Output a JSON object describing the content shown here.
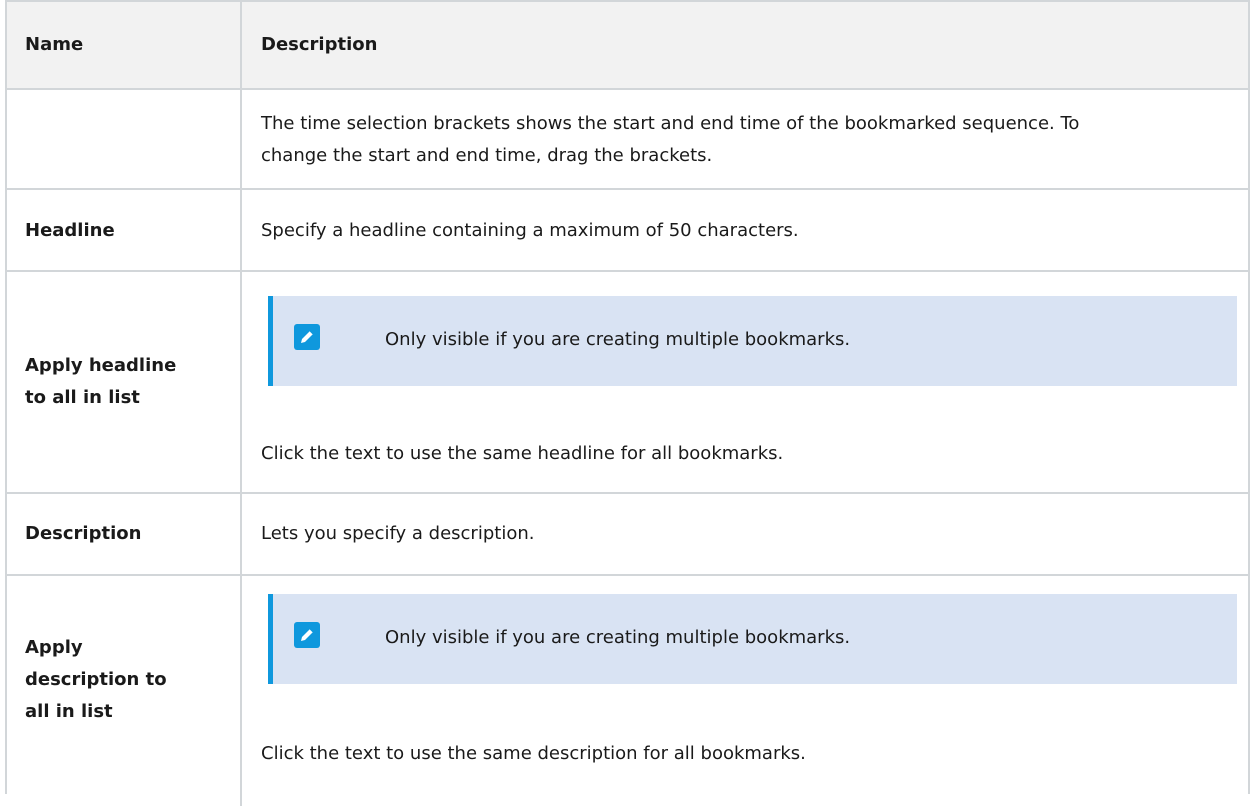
{
  "table": {
    "headers": {
      "name": "Name",
      "description": "Description"
    },
    "rows": [
      {
        "name": "",
        "text": "The time selection brackets shows the start and end time of the bookmarked sequence. To change the start and end time, drag the brackets."
      },
      {
        "name": "Headline",
        "text": "Specify a headline containing a maximum of 50 characters."
      },
      {
        "name": "Apply headline to all in list",
        "note": "Only visible if you are creating multiple bookmarks.",
        "text": "Click the text to use the same headline for all bookmarks."
      },
      {
        "name": "Description",
        "text": "Lets you specify a description."
      },
      {
        "name": "Apply description to all in list",
        "note": "Only visible if you are creating multiple bookmarks.",
        "text": "Click the text to use the same description for all bookmarks."
      }
    ]
  },
  "icons": {
    "note": "pencil-icon"
  },
  "colors": {
    "note_bg": "#d9e3f3",
    "note_accent": "#0f98dd",
    "header_bg": "#f2f2f2"
  }
}
